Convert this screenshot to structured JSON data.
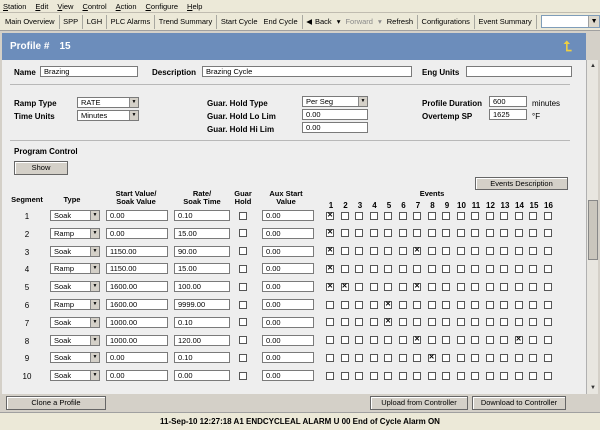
{
  "menu": [
    "Station",
    "Edit",
    "View",
    "Control",
    "Action",
    "Configure",
    "Help"
  ],
  "toolbar": {
    "main_overview": "Main Overview",
    "spp": "SPP",
    "lgh": "LGH",
    "plc_alarms": "PLC Alarms",
    "trend_summary": "Trend Summary",
    "start_cycle": "Start Cycle",
    "end_cycle": "End Cycle",
    "back": "Back",
    "forward": "Forward",
    "refresh": "Refresh",
    "configurations": "Configurations",
    "event_summary": "Event Summary",
    "address_value": ""
  },
  "header": {
    "label": "Profile #",
    "number": "15"
  },
  "form": {
    "name_label": "Name",
    "name_value": "Brazing",
    "description_label": "Description",
    "description_value": "Brazing Cycle",
    "eng_units_label": "Eng Units",
    "eng_units_value": "",
    "ramp_type_label": "Ramp Type",
    "ramp_type_value": "RATE",
    "time_units_label": "Time Units",
    "time_units_value": "Minutes",
    "guar_hold_type_label": "Guar. Hold Type",
    "guar_hold_type_value": "Per Seg",
    "guar_hold_lo_label": "Guar. Hold Lo Lim",
    "guar_hold_lo_value": "0.00",
    "guar_hold_hi_label": "Guar. Hold Hi Lim",
    "guar_hold_hi_value": "0.00",
    "profile_duration_label": "Profile Duration",
    "profile_duration_value": "600",
    "profile_duration_unit": "minutes",
    "overtemp_label": "Overtemp SP",
    "overtemp_value": "1625",
    "overtemp_unit": "°F",
    "program_control_label": "Program Control",
    "show_button": "Show",
    "events_description_button": "Events Description"
  },
  "table": {
    "headers": {
      "segment": "Segment",
      "type": "Type",
      "start1": "Start Value/",
      "start2": "Soak Value",
      "rate1": "Rate/",
      "rate2": "Soak Time",
      "guar1": "Guar",
      "guar2": "Hold",
      "aux1": "Aux Start",
      "aux2": "Value",
      "events": "Events"
    },
    "event_numbers": [
      "1",
      "2",
      "3",
      "4",
      "5",
      "6",
      "7",
      "8",
      "9",
      "10",
      "11",
      "12",
      "13",
      "14",
      "15",
      "16"
    ],
    "rows": [
      {
        "seg": "1",
        "type": "Soak",
        "start": "0.00",
        "rate": "0.10",
        "aux": "0.00",
        "events": [
          1
        ]
      },
      {
        "seg": "2",
        "type": "Ramp",
        "start": "0.00",
        "rate": "15.00",
        "aux": "0.00",
        "events": [
          1
        ]
      },
      {
        "seg": "3",
        "type": "Soak",
        "start": "1150.00",
        "rate": "90.00",
        "aux": "0.00",
        "events": [
          1,
          7
        ]
      },
      {
        "seg": "4",
        "type": "Ramp",
        "start": "1150.00",
        "rate": "15.00",
        "aux": "0.00",
        "events": [
          1
        ]
      },
      {
        "seg": "5",
        "type": "Soak",
        "start": "1600.00",
        "rate": "100.00",
        "aux": "0.00",
        "events": [
          1,
          2,
          7
        ]
      },
      {
        "seg": "6",
        "type": "Ramp",
        "start": "1600.00",
        "rate": "9999.00",
        "aux": "0.00",
        "events": [
          5
        ]
      },
      {
        "seg": "7",
        "type": "Soak",
        "start": "1000.00",
        "rate": "0.10",
        "aux": "0.00",
        "events": [
          5
        ]
      },
      {
        "seg": "8",
        "type": "Soak",
        "start": "1000.00",
        "rate": "120.00",
        "aux": "0.00",
        "events": [
          7,
          14
        ]
      },
      {
        "seg": "9",
        "type": "Soak",
        "start": "0.00",
        "rate": "0.10",
        "aux": "0.00",
        "events": [
          8
        ]
      },
      {
        "seg": "10",
        "type": "Soak",
        "start": "0.00",
        "rate": "0.00",
        "aux": "0.00",
        "events": []
      }
    ]
  },
  "footer": {
    "clone_button": "Clone a Profile",
    "upload_button": "Upload from Controller",
    "download_button": "Download to Controller"
  },
  "status": {
    "text": "11-Sep-10   12:27:18   A1   ENDCYCLEAL    ALARM    U 00  End of Cycle Alarm    ON"
  }
}
